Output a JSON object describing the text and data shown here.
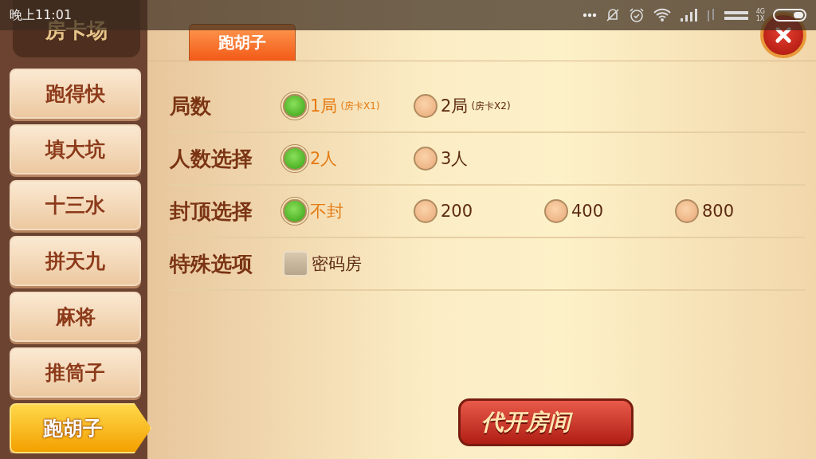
{
  "status_bar": {
    "time": "晚上11:01",
    "network": [
      "4G",
      "1X"
    ]
  },
  "sidebar": {
    "title": "房卡场",
    "items": [
      {
        "label": "跑得快",
        "selected": false
      },
      {
        "label": "填大坑",
        "selected": false
      },
      {
        "label": "十三水",
        "selected": false
      },
      {
        "label": "拼天九",
        "selected": false
      },
      {
        "label": "麻将",
        "selected": false
      },
      {
        "label": "推筒子",
        "selected": false
      },
      {
        "label": "跑胡子",
        "selected": true
      }
    ]
  },
  "tab": {
    "label": "跑胡子"
  },
  "settings": [
    {
      "label": "局数",
      "kind": "radio",
      "options": [
        {
          "text": "1局",
          "note": "(房卡X1)",
          "selected": true
        },
        {
          "text": "2局",
          "note": "(房卡X2)",
          "selected": false
        }
      ]
    },
    {
      "label": "人数选择",
      "kind": "radio",
      "options": [
        {
          "text": "2人",
          "selected": true
        },
        {
          "text": "3人",
          "selected": false
        }
      ]
    },
    {
      "label": "封顶选择",
      "kind": "radio",
      "options": [
        {
          "text": "不封",
          "selected": true
        },
        {
          "text": "200",
          "selected": false
        },
        {
          "text": "400",
          "selected": false
        },
        {
          "text": "800",
          "selected": false
        }
      ]
    },
    {
      "label": "特殊选项",
      "kind": "checkbox",
      "options": [
        {
          "text": "密码房",
          "checked": false
        }
      ]
    }
  ],
  "action_button": "代开房间"
}
